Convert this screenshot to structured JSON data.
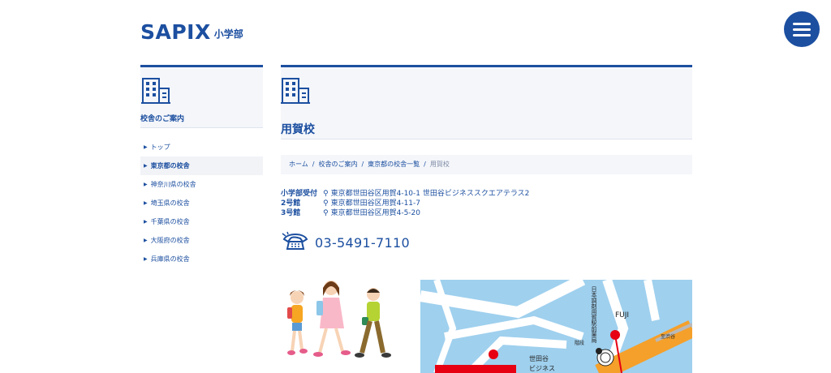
{
  "header": {
    "logo_text": "SAPIX",
    "logo_sub": "小学部",
    "menu_icon": "hamburger-menu-icon"
  },
  "sidebar": {
    "icon": "building-icon",
    "title": "校舎のご案内",
    "items": [
      {
        "label": "トップ"
      },
      {
        "label": "東京都の校舎",
        "active": true
      },
      {
        "label": "神奈川県の校舎"
      },
      {
        "label": "埼玉県の校舎"
      },
      {
        "label": "千葉県の校舎"
      },
      {
        "label": "大阪府の校舎"
      },
      {
        "label": "兵庫県の校舎"
      }
    ]
  },
  "main": {
    "icon": "building-icon",
    "title": "用賀校",
    "breadcrumb": [
      "ホーム",
      "校舎のご案内",
      "東京都の校舎一覧",
      "用賀校"
    ],
    "breadcrumb_sep": "/",
    "addresses": [
      {
        "label": "小学部受付",
        "value": "東京都世田谷区用賀4-10-1 世田谷ビジネススクエアテラス2"
      },
      {
        "label": "2号館",
        "value": "東京都世田谷区用賀4-11-7"
      },
      {
        "label": "3号館",
        "value": "東京都世田谷区用賀4-5-20"
      }
    ],
    "phone": "03-5491-7110"
  },
  "map": {
    "labels": [
      "日本調剤用賀駅前薬局",
      "FUJI",
      "階段",
      "至渋谷",
      "世田谷ビジネス"
    ],
    "colors": {
      "water": "#9fd0ee",
      "road": "#f5a02a",
      "pin": "#e60012"
    }
  },
  "colors": {
    "brand": "#1c4fa0",
    "panel": "#f4f6fa"
  }
}
